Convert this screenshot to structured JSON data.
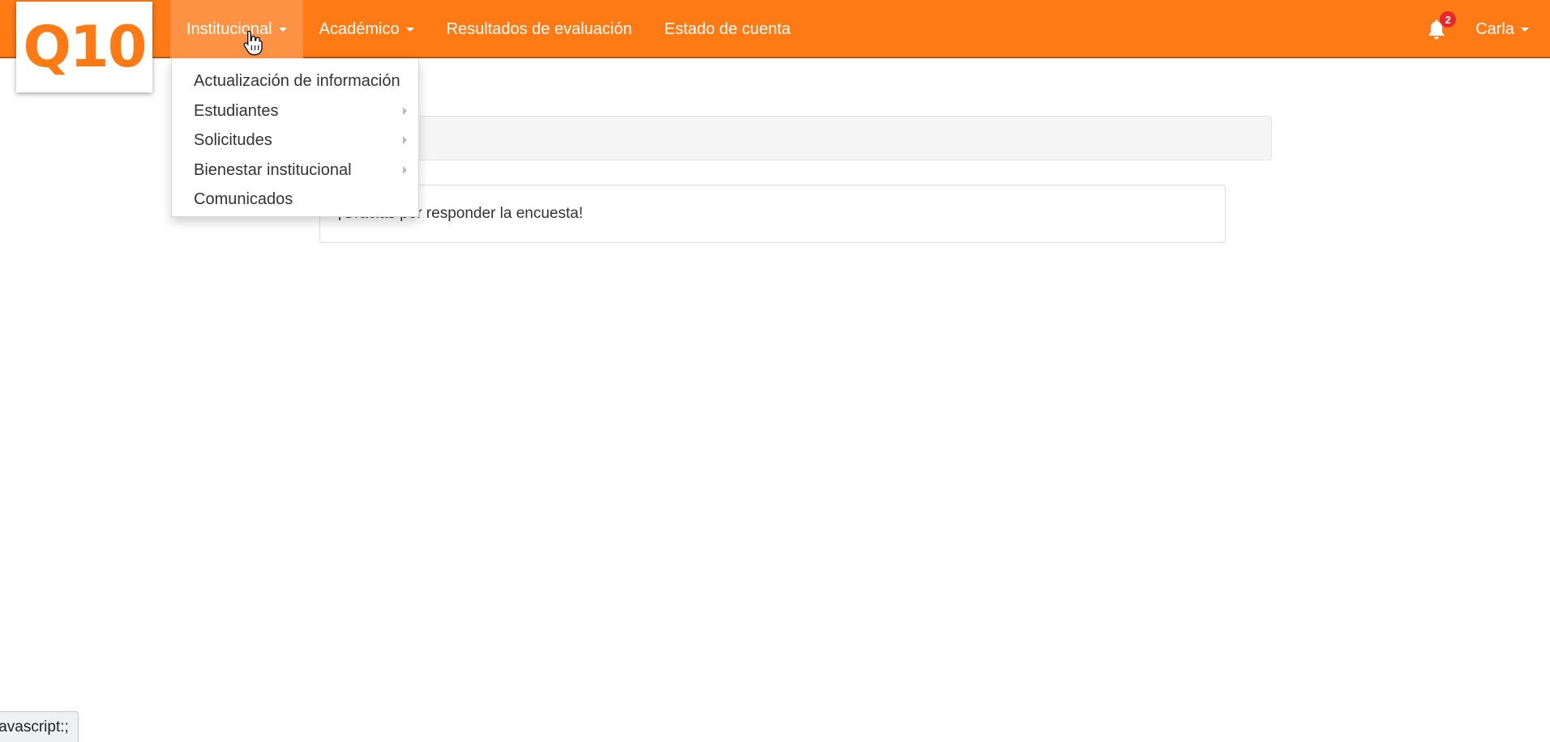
{
  "logo": {
    "text": "Q10"
  },
  "nav": {
    "items": [
      {
        "label": "Institucional",
        "has_caret": true,
        "active": true
      },
      {
        "label": "Académico",
        "has_caret": true
      },
      {
        "label": "Resultados de evaluación"
      },
      {
        "label": "Estado de cuenta"
      }
    ],
    "notifications": {
      "icon": "bell-icon",
      "count": "2"
    },
    "user": {
      "name": "Carla"
    }
  },
  "dropdown": {
    "items": [
      {
        "label": "Actualización de información"
      },
      {
        "label": "Estudiantes",
        "submenu": true
      },
      {
        "label": "Solicitudes",
        "submenu": true
      },
      {
        "label": "Bienestar institucional",
        "submenu": true
      },
      {
        "label": "Comunicados"
      }
    ]
  },
  "main": {
    "message": "¡Gracias por responder la encuesta!"
  },
  "status_bar": {
    "text": "javascript:;"
  },
  "colors": {
    "brand": "#fd7a15",
    "active_nav": "#fd9244",
    "badge": "#e8262d"
  }
}
